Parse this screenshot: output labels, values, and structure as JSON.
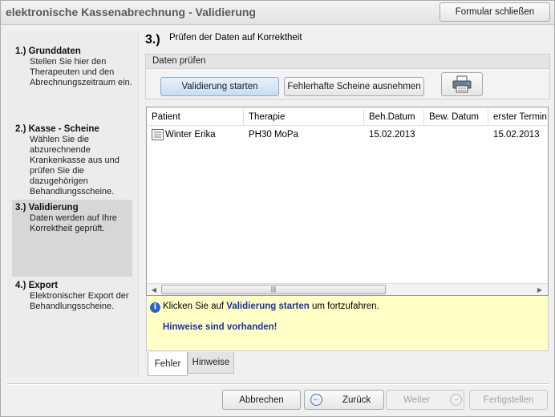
{
  "window": {
    "title": "elektronische Kassenabrechnung - Validierung",
    "close_button": "Formular schließen"
  },
  "sidebar": {
    "steps": [
      {
        "title": "1.) Grunddaten",
        "desc": [
          "Stellen Sie hier den",
          "Therapeuten und den",
          "Abrechnungszeitraum ein."
        ]
      },
      {
        "title": "2.) Kasse - Scheine",
        "desc": [
          "Wählen Sie die",
          "abzurechnende",
          "Krankenkasse aus und",
          "prüfen Sie die",
          "dazugehörigen",
          "Behandlungsscheine."
        ]
      },
      {
        "title": "3.) Validierung",
        "desc": [
          "Daten werden auf Ihre",
          "Korrektheit geprüft."
        ]
      },
      {
        "title": "4.) Export",
        "desc": [
          "Elektronischer Export der",
          "Behandlungsscheine."
        ]
      }
    ],
    "active_step": 3
  },
  "main": {
    "step_number": "3.)",
    "step_title": "Prüfen der Daten auf Korrektheit",
    "group_title": "Daten prüfen",
    "validate_button": "Validierung starten",
    "exclude_button": "Fehlerhafte Scheine ausnehmen",
    "print_icon": "printer-icon"
  },
  "grid": {
    "columns": [
      "Patient",
      "Therapie",
      "Beh.Datum",
      "Bew. Datum",
      "erster Termin"
    ],
    "rows": [
      {
        "patient": "Winter Erika",
        "therapie": "PH30 MoPa",
        "beh_datum": "15.02.2013",
        "bew_datum": "",
        "erster_termin": "15.02.2013"
      }
    ]
  },
  "info": {
    "line1_prefix": "Klicken Sie auf",
    "line1_link": "Validierung starten",
    "line1_suffix": "um fortzufahren.",
    "line2": "Hinweise sind vorhanden!"
  },
  "tabs": {
    "fehler": "Fehler",
    "hinweise": "Hinweise",
    "active": "fehler"
  },
  "footer": {
    "abbrechen": "Abbrechen",
    "zurueck": "Zurück",
    "weiter": "Weiter",
    "fertigstellen": "Fertigstellen"
  }
}
